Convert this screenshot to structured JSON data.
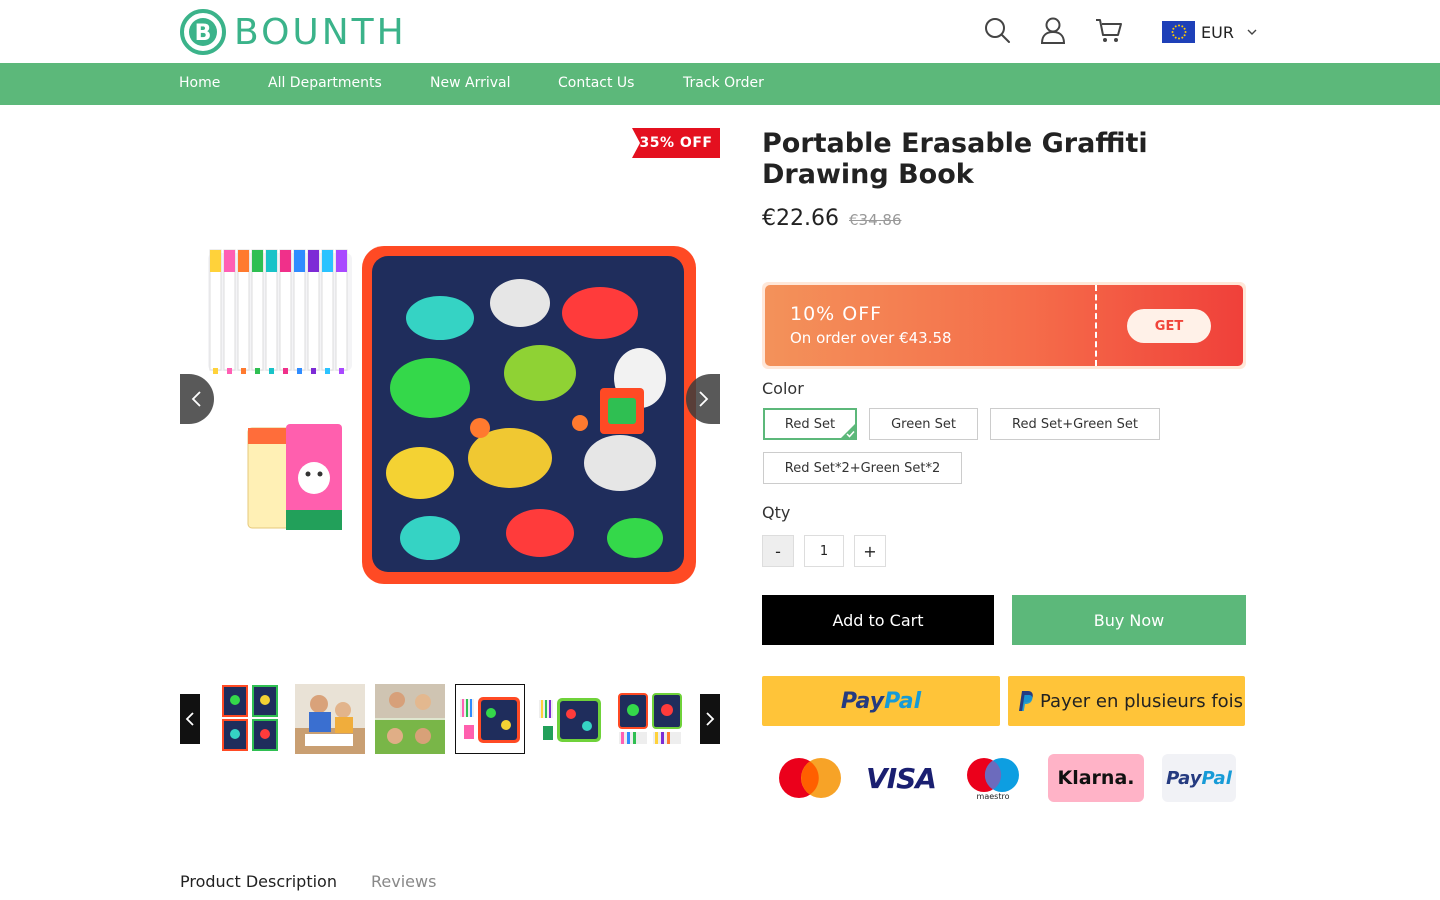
{
  "header": {
    "logo_text": "BOUNTH",
    "currency": "EUR"
  },
  "nav": {
    "items": [
      "Home",
      "All Departments",
      "New Arrival",
      "Contact Us",
      "Track Order"
    ]
  },
  "gallery": {
    "badge": "35% OFF"
  },
  "product": {
    "title": "Portable Erasable Graffiti Drawing Book",
    "price": "€22.66",
    "old_price": "€34.86",
    "coupon": {
      "title": "10% OFF",
      "subtitle": "On order over €43.58",
      "button": "GET"
    },
    "color_label": "Color",
    "colors": [
      "Red Set",
      "Green Set",
      "Red Set+Green Set",
      "Red Set*2+Green Set*2"
    ],
    "selected_color": "Red Set",
    "qty_label": "Qty",
    "qty_minus": "-",
    "qty_value": "1",
    "qty_plus": "+",
    "add_to_cart": "Add to Cart",
    "buy_now": "Buy Now",
    "paypal_a": "Pay",
    "paypal_b": "Pal",
    "paylater": "Payer en plusieurs fois"
  },
  "payment_logos": {
    "visa": "VISA",
    "maestro": "maestro",
    "klarna": "Klarna.",
    "paypal_a": "Pay",
    "paypal_b": "Pal"
  },
  "tabs": {
    "description": "Product Description",
    "reviews": "Reviews"
  },
  "colors": {
    "brand_green": "#5cb87a",
    "logo_green": "#3bb38a",
    "badge_red": "#e4101f",
    "paypal_yellow": "#ffc439"
  }
}
